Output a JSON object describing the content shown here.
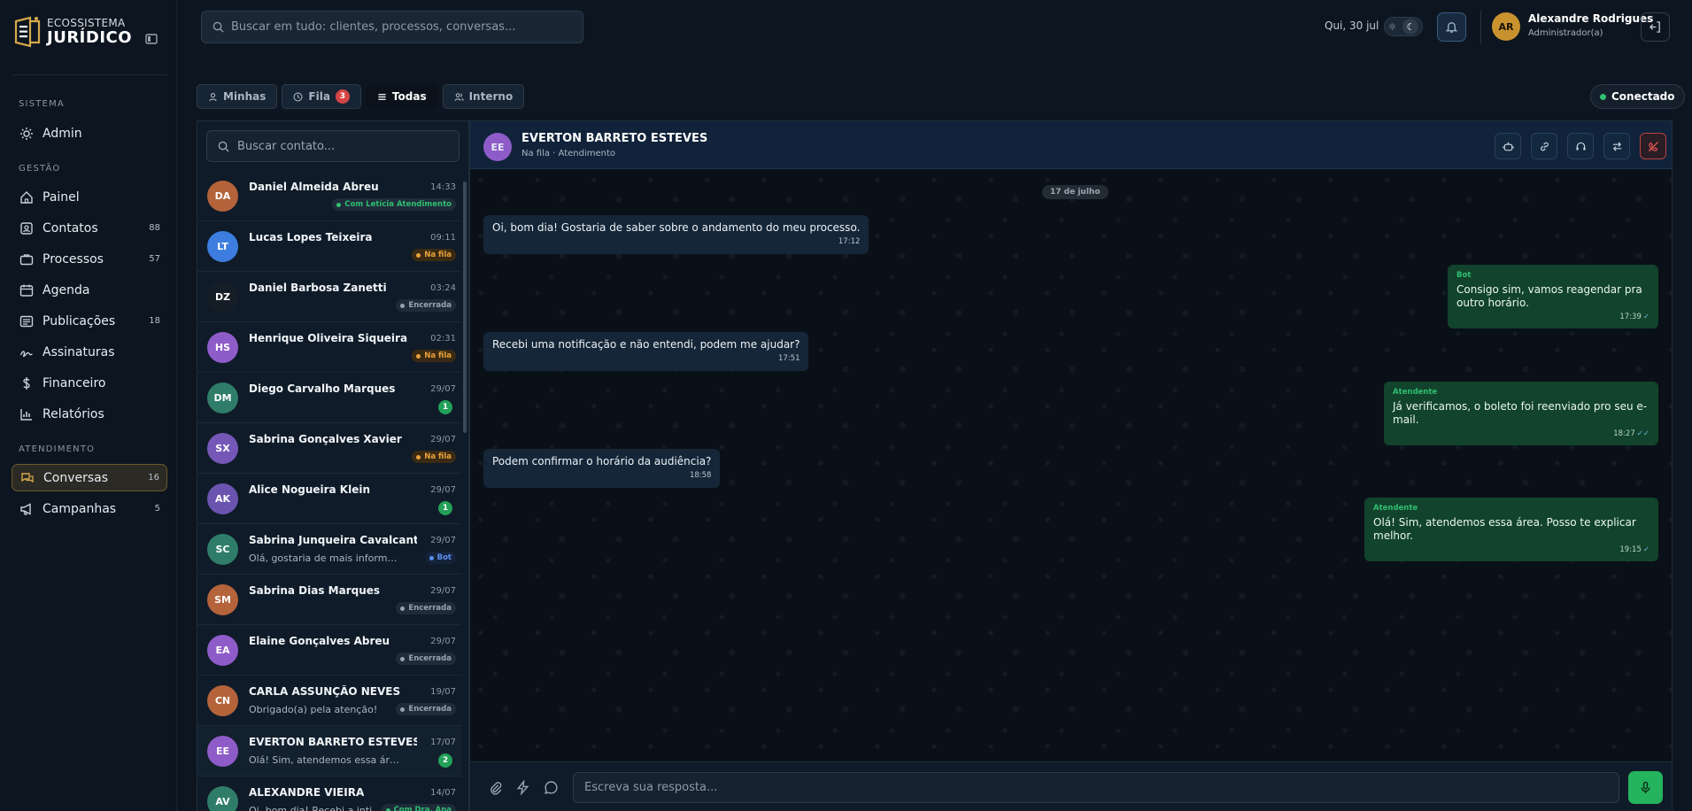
{
  "brand": {
    "line1": "ECOSSISTEMA",
    "line2": "JURÍDICO"
  },
  "colors": {
    "accent": "#d6a94b",
    "online": "#2fbf71",
    "outgoing_bubble": "#12432c",
    "incoming_bubble": "#152638"
  },
  "sidebar": {
    "sections": [
      {
        "title": "SISTEMA",
        "items": [
          {
            "label": "Admin",
            "icon": "admin-icon",
            "count": ""
          }
        ]
      },
      {
        "title": "GESTÃO",
        "items": [
          {
            "label": "Painel",
            "icon": "home-icon",
            "count": ""
          },
          {
            "label": "Contatos",
            "icon": "contacts-icon",
            "count": "88"
          },
          {
            "label": "Processos",
            "icon": "briefcase-icon",
            "count": "57"
          },
          {
            "label": "Agenda",
            "icon": "calendar-icon",
            "count": ""
          },
          {
            "label": "Publicações",
            "icon": "newspaper-icon",
            "count": "18"
          },
          {
            "label": "Assinaturas",
            "icon": "signature-icon",
            "count": ""
          },
          {
            "label": "Financeiro",
            "icon": "dollar-icon",
            "count": ""
          },
          {
            "label": "Relatórios",
            "icon": "chart-icon",
            "count": ""
          }
        ]
      },
      {
        "title": "ATENDIMENTO",
        "items": [
          {
            "label": "Conversas",
            "icon": "chat-icon",
            "count": "16",
            "active": true
          },
          {
            "label": "Campanhas",
            "icon": "megaphone-icon",
            "count": "5"
          }
        ]
      }
    ]
  },
  "topbar": {
    "search_placeholder": "Buscar em tudo: clientes, processos, conversas...",
    "date": "Qui, 30 jul",
    "user": {
      "initials": "AR",
      "name": "Alexandre Rodrigues",
      "role": "Administrador(a)"
    }
  },
  "filters": {
    "tabs": [
      {
        "label": "Minhas",
        "icon": "user-icon"
      },
      {
        "label": "Fila",
        "icon": "clock-icon",
        "badge": "3"
      },
      {
        "label": "Todas",
        "icon": "list-icon",
        "active": true
      },
      {
        "label": "Interno",
        "icon": "users-icon"
      }
    ],
    "status": "Conectado"
  },
  "contacts": {
    "search_placeholder": "Buscar contato...",
    "items": [
      {
        "initials": "DA",
        "color": "#b4633a",
        "name": "Daniel Almeida Abreu",
        "time": "14:33",
        "preview": "",
        "tag": "Com Letícia Atendimento",
        "tag_kind": "agent"
      },
      {
        "initials": "LT",
        "color": "#3d7de0",
        "name": "Lucas Lopes Teixeira",
        "time": "09:11",
        "preview": "",
        "tag": "Na fila",
        "tag_kind": "queue"
      },
      {
        "initials": "DZ",
        "color": "#151d26",
        "name": "Daniel Barbosa Zanetti",
        "time": "03:24",
        "preview": "",
        "tag": "Encerrada",
        "tag_kind": "closed"
      },
      {
        "initials": "HS",
        "color": "#8e5cc8",
        "name": "Henrique Oliveira Siqueira",
        "time": "02:31",
        "preview": "",
        "tag": "Na fila",
        "tag_kind": "queue"
      },
      {
        "initials": "DM",
        "color": "#2f7d68",
        "name": "Diego Carvalho Marques",
        "time": "29/07",
        "preview": "",
        "unread": "1"
      },
      {
        "initials": "SX",
        "color": "#7557b8",
        "name": "Sabrina Gonçalves Xavier",
        "time": "29/07",
        "preview": "",
        "tag": "Na fila",
        "tag_kind": "queue"
      },
      {
        "initials": "AK",
        "color": "#6a54b0",
        "name": "Alice Nogueira Klein",
        "time": "29/07",
        "preview": "",
        "unread": "1"
      },
      {
        "initials": "SC",
        "color": "#2f7d68",
        "name": "Sabrina Junqueira Cavalcante",
        "time": "29/07",
        "preview": "Olá, gostaria de mais informações.",
        "tag": "Bot",
        "tag_kind": "bot"
      },
      {
        "initials": "SM",
        "color": "#b4633a",
        "name": "Sabrina Dias Marques",
        "time": "29/07",
        "preview": "",
        "tag": "Encerrada",
        "tag_kind": "closed"
      },
      {
        "initials": "EA",
        "color": "#8e5cc8",
        "name": "Elaine Gonçalves Abreu",
        "time": "29/07",
        "preview": "",
        "tag": "Encerrada",
        "tag_kind": "closed"
      },
      {
        "initials": "CN",
        "color": "#b4633a",
        "name": "CARLA ASSUNÇÃO NEVES",
        "time": "19/07",
        "preview": "Obrigado(a) pela atenção!",
        "tag": "Encerrada",
        "tag_kind": "closed"
      },
      {
        "initials": "EE",
        "color": "#8e5cc8",
        "name": "EVERTON BARRETO ESTEVES",
        "time": "17/07",
        "preview": "Olá! Sim, atendemos essa área. Posso...",
        "unread": "2",
        "selected": true
      },
      {
        "initials": "AV",
        "color": "#2f7d68",
        "name": "ALEXANDRE VIEIRA",
        "time": "14/07",
        "preview": "Oi, bom dia! Recebi a inti...",
        "tag": "Com Dra. Ana",
        "tag_kind": "agent"
      }
    ]
  },
  "chat": {
    "header": {
      "initials": "EE",
      "name": "EVERTON BARRETO ESTEVES",
      "subtitle": "Na fila · Atendimento"
    },
    "actions": [
      {
        "icon": "bot-icon"
      },
      {
        "icon": "link-icon"
      },
      {
        "icon": "headset-icon"
      },
      {
        "icon": "transfer-icon"
      },
      {
        "icon": "end-call-icon",
        "danger": true
      }
    ],
    "day": "17 de julho",
    "messages": [
      {
        "dir": "in",
        "text": "Oi, bom dia! Gostaria de saber sobre o andamento do meu processo.",
        "time": "17:12"
      },
      {
        "dir": "out",
        "sender": "Bot",
        "text": "Consigo sim, vamos reagendar pra outro horário.",
        "time": "17:39",
        "ticks": "✓"
      },
      {
        "dir": "in",
        "text": "Recebi uma notificação e não entendi, podem me ajudar?",
        "time": "17:51"
      },
      {
        "dir": "out",
        "sender": "Atendente",
        "text": "Já verificamos, o boleto foi reenviado pro seu e-mail.",
        "time": "18:27",
        "ticks": "✓✓"
      },
      {
        "dir": "in",
        "text": "Podem confirmar o horário da audiência?",
        "time": "18:58"
      },
      {
        "dir": "out",
        "sender": "Atendente",
        "text": "Olá! Sim, atendemos essa área. Posso te explicar melhor.",
        "time": "19:15",
        "ticks": "✓"
      }
    ],
    "composer_placeholder": "Escreva sua resposta..."
  }
}
